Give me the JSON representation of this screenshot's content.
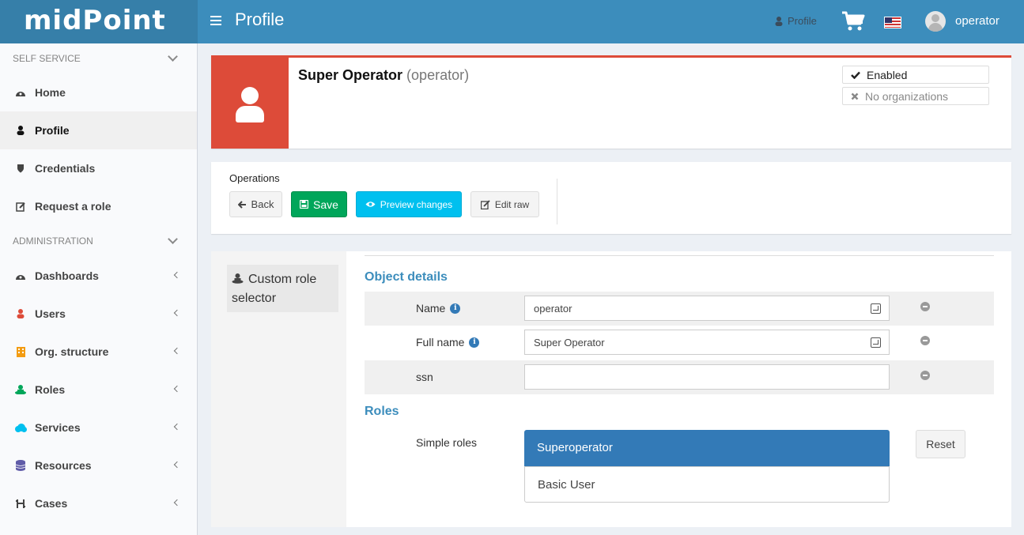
{
  "header": {
    "logo": "midPoint",
    "title": "Profile",
    "profile_link": "Profile",
    "username": "operator"
  },
  "sidebar": {
    "sections": [
      {
        "label": "SELF SERVICE",
        "items": [
          {
            "label": "Home",
            "icon": "dashboard-icon",
            "active": false
          },
          {
            "label": "Profile",
            "icon": "user-icon",
            "active": true
          },
          {
            "label": "Credentials",
            "icon": "shield-icon",
            "active": false
          },
          {
            "label": "Request a role",
            "icon": "edit-icon",
            "active": false
          }
        ]
      },
      {
        "label": "ADMINISTRATION",
        "items": [
          {
            "label": "Dashboards",
            "icon": "dashboard-icon"
          },
          {
            "label": "Users",
            "icon": "user-icon"
          },
          {
            "label": "Org. structure",
            "icon": "building-icon"
          },
          {
            "label": "Roles",
            "icon": "role-icon"
          },
          {
            "label": "Services",
            "icon": "cloud-icon"
          },
          {
            "label": "Resources",
            "icon": "database-icon"
          },
          {
            "label": "Cases",
            "icon": "cases-icon"
          }
        ]
      }
    ]
  },
  "summary": {
    "display_name": "Super Operator",
    "name": "(operator)",
    "status": "Enabled",
    "orgs": "No organizations",
    "accent_color": "#dd4b39"
  },
  "operations": {
    "label": "Operations",
    "back": "Back",
    "save": "Save",
    "preview": "Preview changes",
    "edit_raw": "Edit raw"
  },
  "tabs": {
    "active": "Custom role selector"
  },
  "form": {
    "object_details_title": "Object details",
    "fields": [
      {
        "label": "Name",
        "value": "operator",
        "info": true
      },
      {
        "label": "Full name",
        "value": "Super Operator",
        "info": true
      },
      {
        "label": "ssn",
        "value": "",
        "info": false
      }
    ],
    "roles_title": "Roles",
    "simple_roles_label": "Simple roles",
    "roles": [
      {
        "label": "Superoperator",
        "selected": true
      },
      {
        "label": "Basic User",
        "selected": false
      }
    ],
    "reset": "Reset"
  }
}
